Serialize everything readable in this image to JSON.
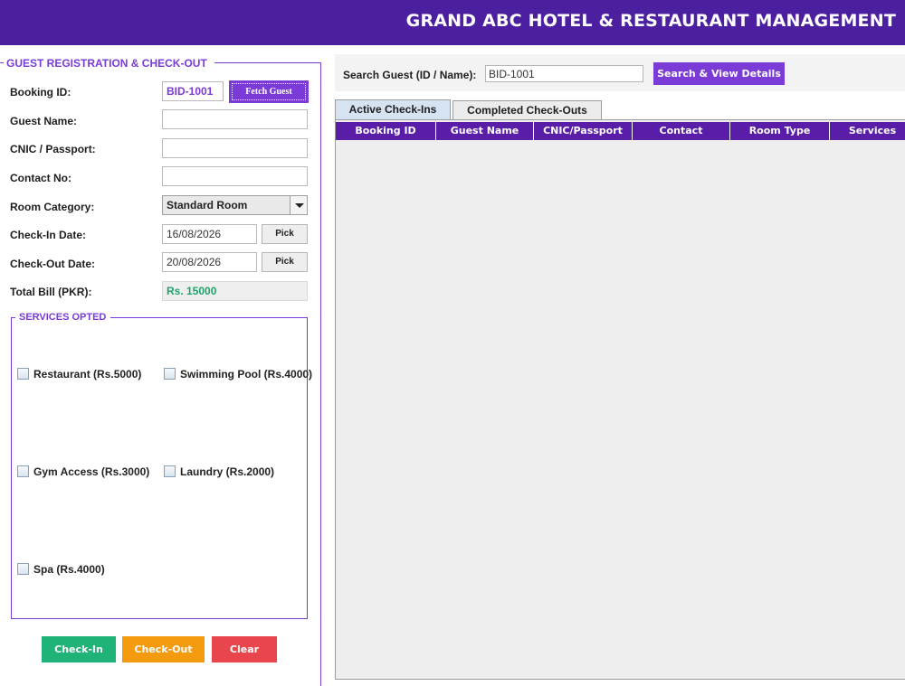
{
  "header": {
    "title": "GRAND ABC HOTEL & RESTAURANT MANAGEMENT"
  },
  "form": {
    "section_title": "GUEST REGISTRATION & CHECK-OUT",
    "booking_id_label": "Booking ID:",
    "booking_id_value": "BID-1001",
    "fetch_button": "Fetch Guest",
    "guest_name_label": "Guest Name:",
    "guest_name_value": "",
    "cnic_label": "CNIC / Passport:",
    "cnic_value": "",
    "contact_label": "Contact No:",
    "contact_value": "",
    "room_category_label": "Room Category:",
    "room_category_value": "Standard Room",
    "checkin_label": "Check-In Date:",
    "checkin_value": "16/08/2026",
    "checkout_label": "Check-Out Date:",
    "checkout_value": "20/08/2026",
    "pick_label": "Pick",
    "total_bill_label": "Total Bill (PKR):",
    "total_bill_value": "Rs. 15000"
  },
  "services": {
    "title": "SERVICES OPTED",
    "items": [
      {
        "label": "Restaurant (Rs.5000)",
        "checked": false
      },
      {
        "label": "Swimming Pool (Rs.4000)",
        "checked": false
      },
      {
        "label": "Gym Access (Rs.3000)",
        "checked": false
      },
      {
        "label": "Laundry (Rs.2000)",
        "checked": false
      },
      {
        "label": "Spa (Rs.4000)",
        "checked": false
      }
    ]
  },
  "actions": {
    "checkin": "Check-In",
    "checkout": "Check-Out",
    "clear": "Clear"
  },
  "search": {
    "label": "Search Guest (ID / Name):",
    "value": "BID-1001",
    "button": "Search & View Details"
  },
  "tabs": [
    {
      "label": "Active Check-Ins",
      "active": true
    },
    {
      "label": "Completed Check-Outs",
      "active": false
    }
  ],
  "table": {
    "columns": [
      "Booking ID",
      "Guest Name",
      "CNIC/Passport",
      "Contact",
      "Room Type",
      "Services"
    ],
    "rows": []
  },
  "colors": {
    "header_bg": "#4b1fa0",
    "accent": "#7a3bd6",
    "checkin": "#1fb377",
    "checkout": "#f39a0f",
    "clear": "#e8454c"
  }
}
